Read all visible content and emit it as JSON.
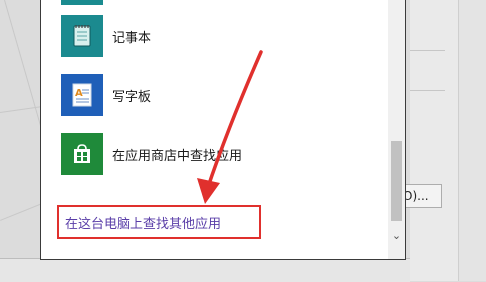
{
  "apps": [
    {
      "name": "notepad",
      "label": "记事本",
      "icon": "notepad-icon",
      "color": "#1b8a8f"
    },
    {
      "name": "wordpad",
      "label": "写字板",
      "icon": "wordpad-icon",
      "color": "#1f5fb8"
    },
    {
      "name": "store",
      "label": "在应用商店中查找应用",
      "icon": "store-icon",
      "color": "#1f8a3a"
    }
  ],
  "more_apps_link": "在这台电脑上查找其他应用",
  "background_button": "O)...",
  "annotation_color": "#e0302d",
  "scroll_down_glyph": "⌄"
}
